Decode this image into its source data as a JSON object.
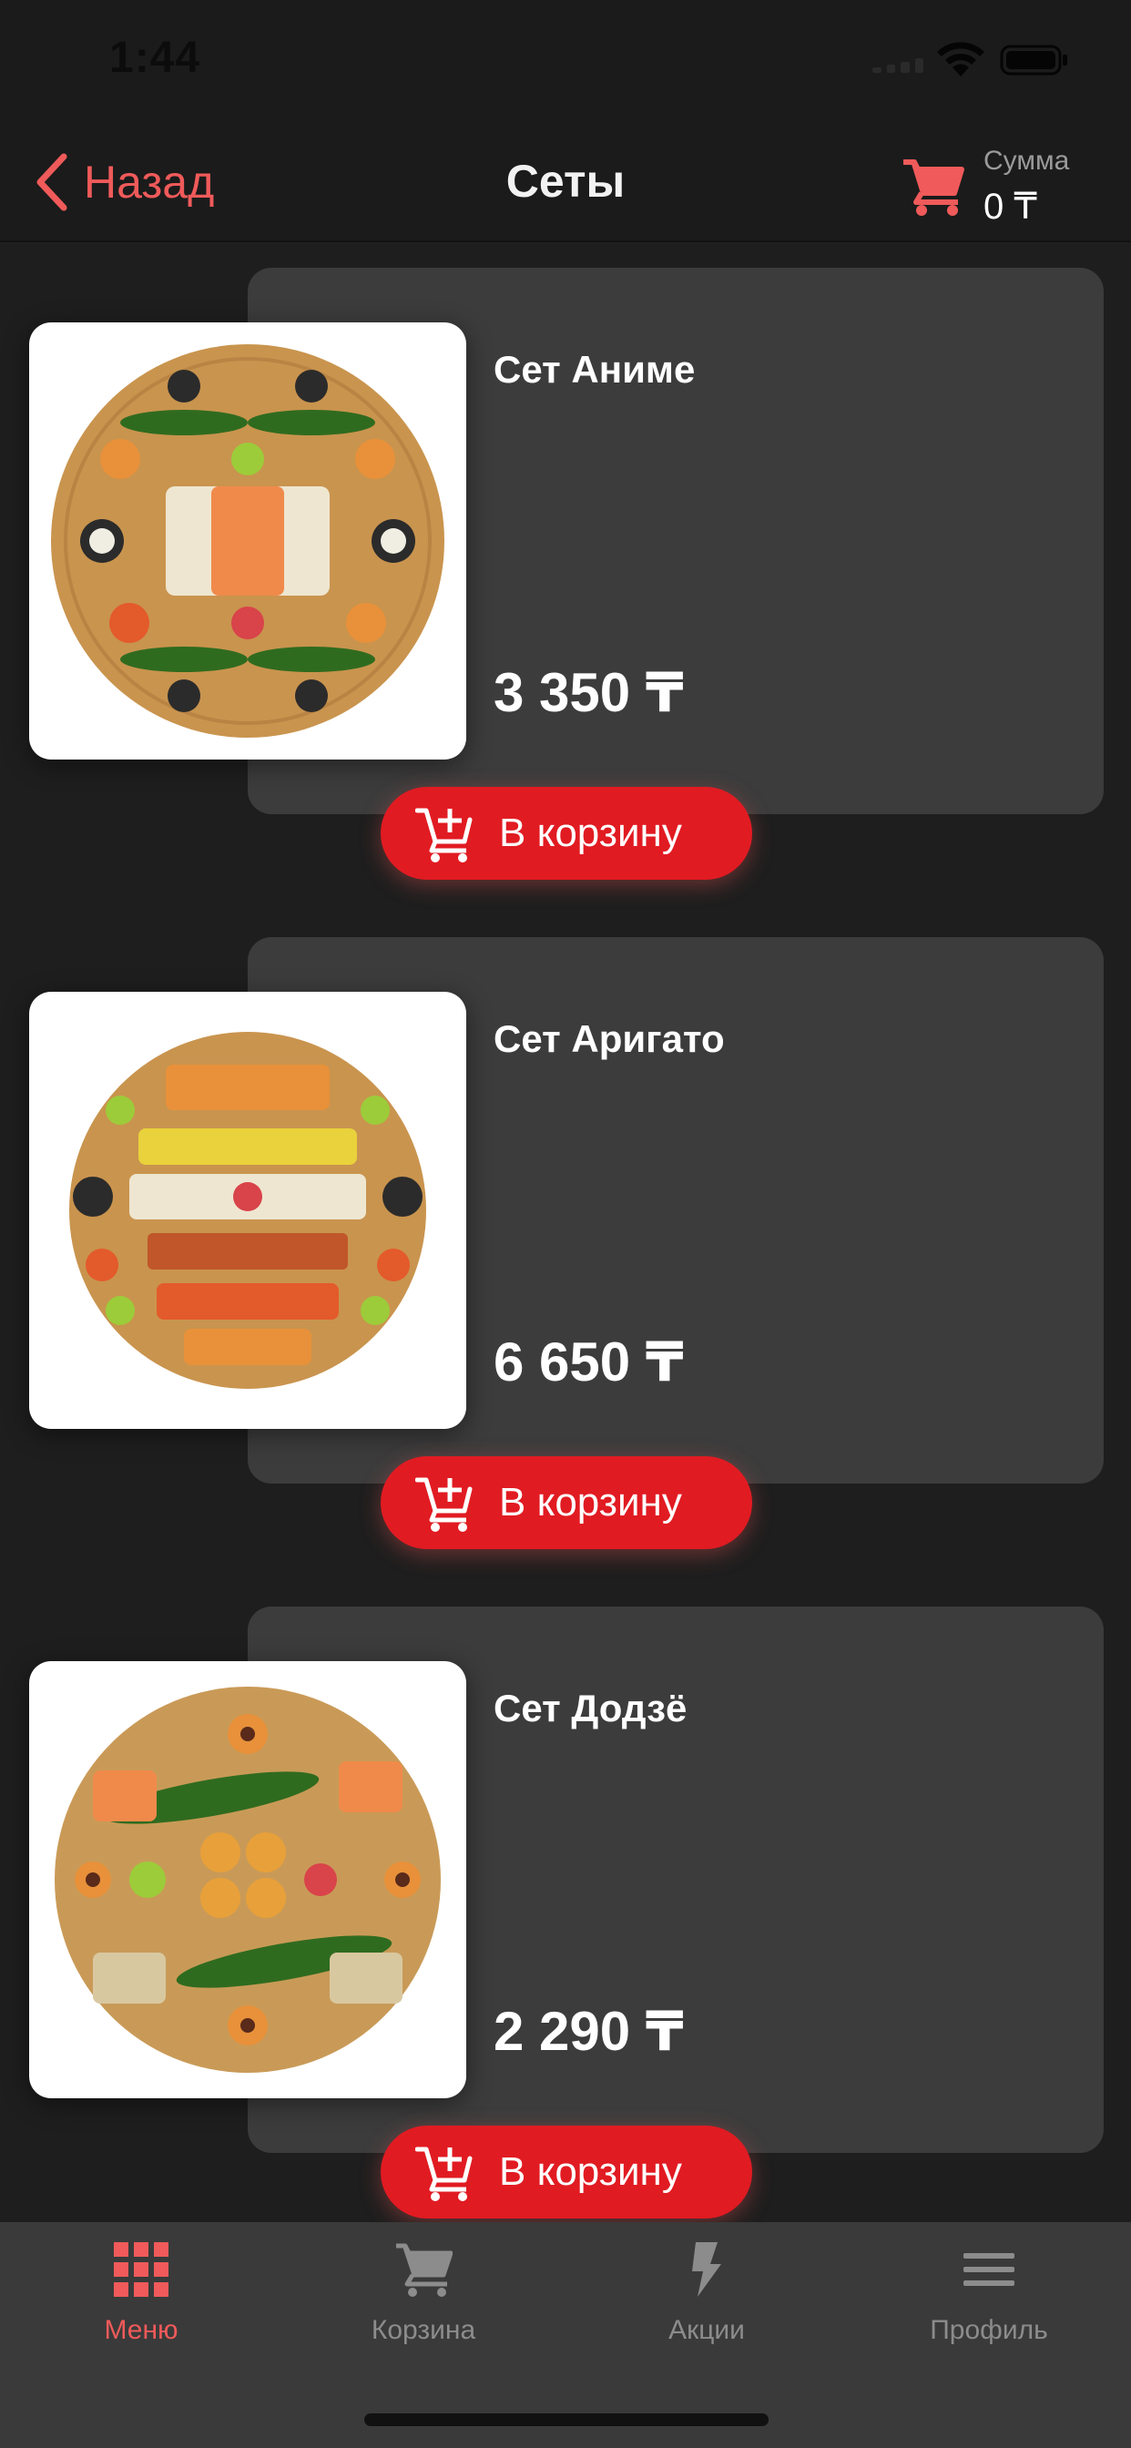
{
  "status": {
    "time": "1:44"
  },
  "header": {
    "back_label": "Назад",
    "title": "Сеты",
    "sum_label": "Сумма",
    "sum_value": "0 ₸"
  },
  "products": [
    {
      "name": "Сет Аниме",
      "price": "3 350 ₸",
      "add_label": "В корзину"
    },
    {
      "name": "Сет Аригато",
      "price": "6 650 ₸",
      "add_label": "В корзину"
    },
    {
      "name": "Сет Додзё",
      "price": "2 290 ₸",
      "add_label": "В корзину"
    }
  ],
  "tabs": [
    {
      "label": "Меню",
      "icon": "grid-icon",
      "active": true
    },
    {
      "label": "Корзина",
      "icon": "cart-icon",
      "active": false
    },
    {
      "label": "Акции",
      "icon": "lightning-icon",
      "active": false
    },
    {
      "label": "Профиль",
      "icon": "menu-lines-icon",
      "active": false
    }
  ],
  "colors": {
    "accent": "#e11b22",
    "accent_text": "#f05a5a",
    "background": "#1e1e1e",
    "card": "#3c3c3c",
    "tab_bar": "#3a3a3a"
  }
}
